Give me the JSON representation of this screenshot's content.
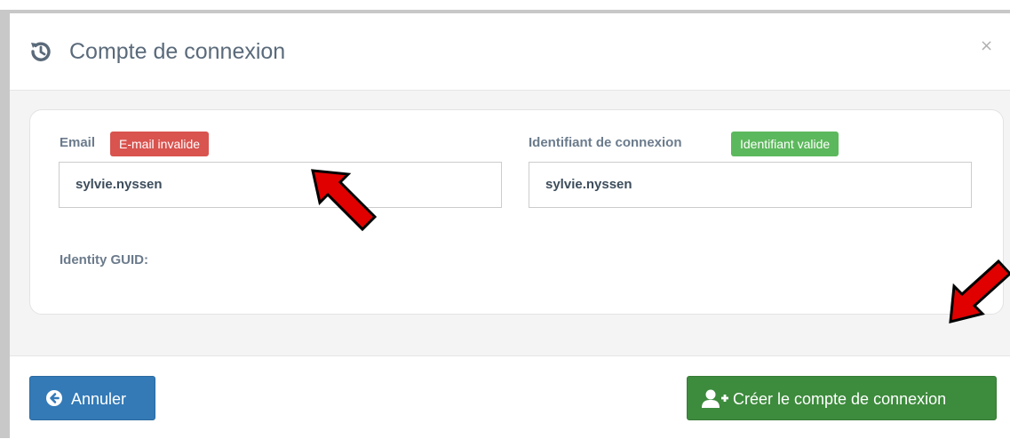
{
  "dialog": {
    "title": "Compte de connexion",
    "title_icon": "history-icon",
    "close_label": "×"
  },
  "form": {
    "email": {
      "label": "Email",
      "badge": "E-mail invalide",
      "value": "sylvie.nyssen"
    },
    "login_id": {
      "label": "Identifiant de connexion",
      "badge": "Identifiant valide",
      "value": "sylvie.nyssen"
    },
    "identity_guid_label": "Identity GUID:"
  },
  "footer": {
    "cancel_label": "Annuler",
    "cancel_icon": "arrow-circle-left-icon",
    "create_label": "Créer le compte de connexion",
    "create_icon": "user-plus-icon"
  },
  "colors": {
    "invalid_badge": "#d9534f",
    "valid_badge": "#5cb85c",
    "cancel_button": "#337ab7",
    "create_button": "#3d8b3d",
    "annotation_arrow": "#e00000"
  }
}
